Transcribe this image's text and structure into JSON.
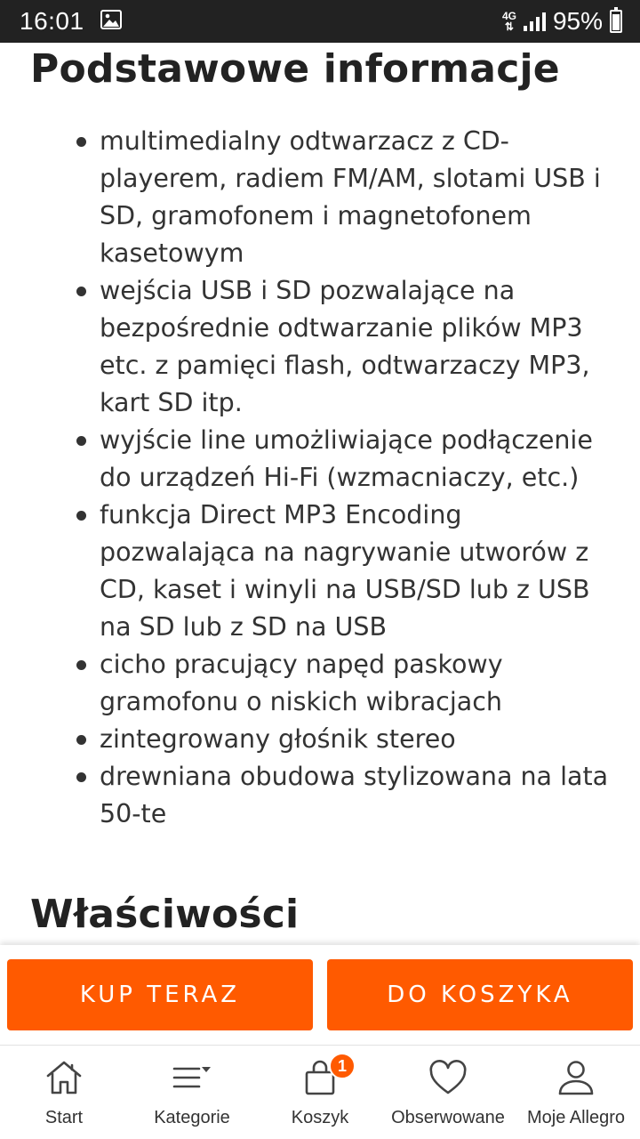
{
  "status_bar": {
    "time": "16:01",
    "network": "4G",
    "battery": "95%"
  },
  "sections": {
    "basic_info_title": "Podstawowe informacje",
    "features": [
      "multimedialny odtwarzacz z CD-playerem, radiem FM/AM, slotami USB i SD, gramofonem i magnetofonem kasetowym",
      "wejścia USB i SD pozwalające na bezpośrednie odtwarzanie plików MP3 etc. z pamięci flash, odtwarzaczy MP3, kart SD itp.",
      "wyjście line umożliwiające podłączenie do urządzeń Hi-Fi (wzmacniaczy, etc.)",
      "funkcja Direct MP3 Encoding pozwalająca na nagrywanie utworów z CD, kaset i winyli na USB/SD lub z USB na SD lub z SD na USB",
      "cicho pracujący napęd paskowy gramofonu o niskich wibracjach",
      "zintegrowany głośnik stereo",
      "drewniana obudowa stylizowana na lata 50-te"
    ],
    "properties_title": "Właściwości"
  },
  "actions": {
    "buy_now": "KUP TERAZ",
    "add_to_cart": "DO KOSZYKA"
  },
  "nav": {
    "start": "Start",
    "categories": "Kategorie",
    "cart": "Koszyk",
    "cart_badge": "1",
    "watched": "Obserwowane",
    "my_allegro": "Moje Allegro"
  },
  "colors": {
    "accent": "#ff5a00",
    "status_bar": "#222222"
  }
}
